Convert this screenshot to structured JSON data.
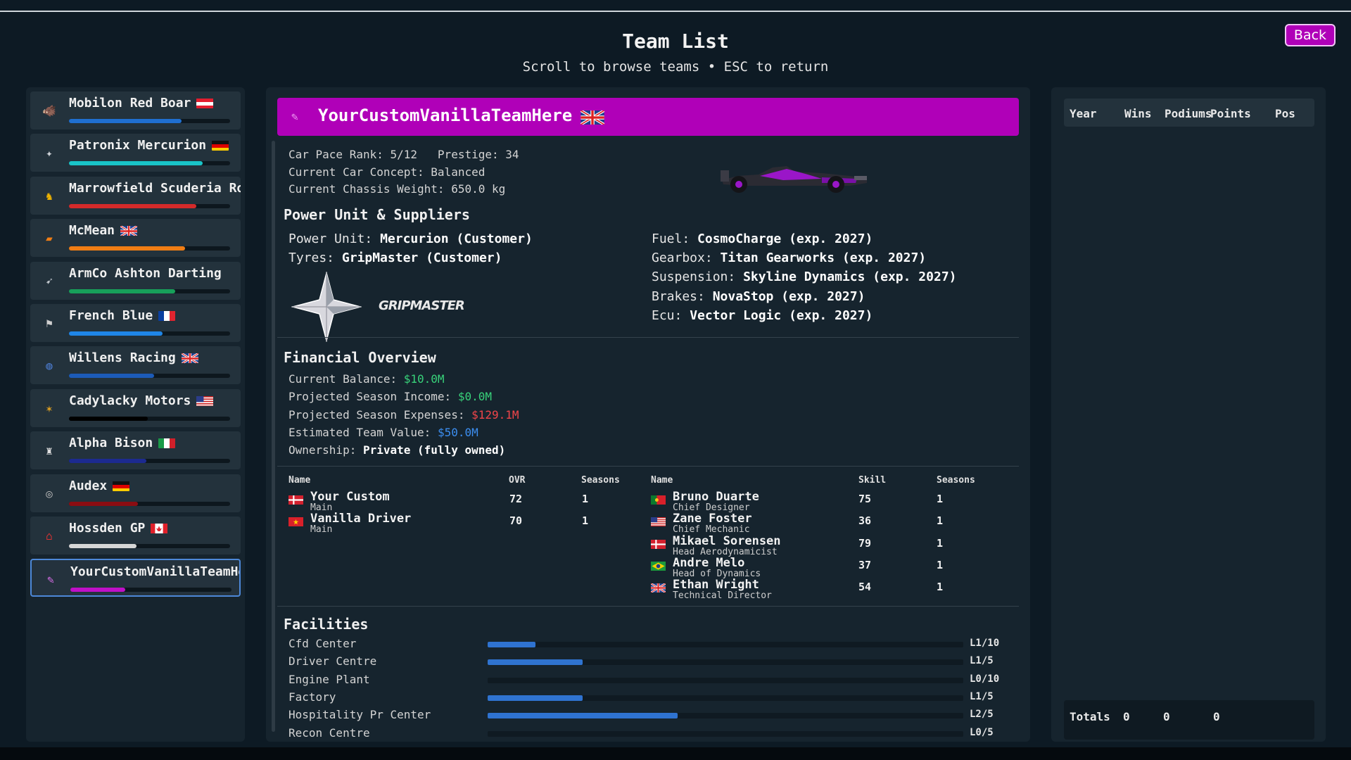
{
  "header": {
    "title": "Team List",
    "subtitle": "Scroll to browse teams • ESC to return",
    "back_label": "Back"
  },
  "teams": [
    {
      "name": "Mobilon Red Boar",
      "flag": "austria",
      "logo": "boar-logo-icon",
      "bar_color": "#1f6fd0",
      "performance": 0.7
    },
    {
      "name": "Patronix Mercurion",
      "flag": "germany",
      "logo": "star-logo-icon",
      "bar_color": "#19c4c8",
      "performance": 0.83
    },
    {
      "name": "Marrowfield Scuderia Ro",
      "flag": "",
      "logo": "horse-logo-icon",
      "bar_color": "#d42a2a",
      "performance": 0.79
    },
    {
      "name": "McMean",
      "flag": "uk",
      "logo": "mcmean-logo-icon",
      "bar_color": "#f07d14",
      "performance": 0.72
    },
    {
      "name": "ArmCo Ashton Darting",
      "flag": "",
      "logo": "wing-logo-icon",
      "bar_color": "#17a05a",
      "performance": 0.66
    },
    {
      "name": "French Blue",
      "flag": "france",
      "logo": "flag-logo-icon",
      "bar_color": "#1f86e8",
      "performance": 0.58
    },
    {
      "name": "Willens Racing",
      "flag": "uk",
      "logo": "w-logo-icon",
      "bar_color": "#1c5bb8",
      "performance": 0.53
    },
    {
      "name": "Cadylacky Motors",
      "flag": "usa",
      "logo": "crest-logo-icon",
      "bar_color": "#000000",
      "performance": 0.49
    },
    {
      "name": "Alpha Bison",
      "flag": "italy",
      "logo": "bison-logo-icon",
      "bar_color": "#1c2a90",
      "performance": 0.48
    },
    {
      "name": "Audex",
      "flag": "germany",
      "logo": "rings-logo-icon",
      "bar_color": "#8b0d12",
      "performance": 0.43
    },
    {
      "name": "Hossden GP",
      "flag": "canada",
      "logo": "h-logo-icon",
      "bar_color": "#d6d6d6",
      "performance": 0.42
    },
    {
      "name": "YourCustomVanillaTeamHe",
      "flag": "",
      "logo": "custom-logo-icon",
      "bar_color": "#c010c8",
      "performance": 0.34,
      "selected": true
    }
  ],
  "selected_team": {
    "name": "YourCustomVanillaTeamHere",
    "banner_color": "#b000b8",
    "flag": "uk",
    "pace_rank_line": "Car Pace Rank: 5/12   Prestige: 34",
    "concept_line": "Current Car Concept: Balanced",
    "chassis_line": "Current Chassis Weight: 650.0 kg"
  },
  "power_unit": {
    "title": "Power Unit & Suppliers",
    "power_unit_label": "Power Unit:",
    "power_unit_value": "Mercurion (Customer)",
    "tyres_label": "Tyres:",
    "tyres_value": "GripMaster (Customer)",
    "tyre_brand_logo": "GRIPMASTER",
    "suppliers": [
      {
        "label": "Fuel:",
        "value": "CosmoCharge (exp. 2027)"
      },
      {
        "label": "Gearbox:",
        "value": "Titan Gearworks (exp. 2027)"
      },
      {
        "label": "Suspension:",
        "value": "Skyline Dynamics (exp. 2027)"
      },
      {
        "label": "Brakes:",
        "value": "NovaStop (exp. 2027)"
      },
      {
        "label": "Ecu:",
        "value": "Vector Logic (exp. 2027)"
      }
    ]
  },
  "financial": {
    "title": "Financial Overview",
    "balance_label": "Current Balance:",
    "balance_value": "$10.0M",
    "income_label": "Projected Season Income:",
    "income_value": "$0.0M",
    "expenses_label": "Projected Season Expenses:",
    "expenses_value": "$129.1M",
    "value_label": "Estimated Team Value:",
    "value_value": "$50.0M",
    "ownership_label": "Ownership:",
    "ownership_value": "Private (fully owned)"
  },
  "drivers": {
    "headers": {
      "name": "Name",
      "ovr": "OVR",
      "seasons": "Seasons"
    },
    "rows": [
      {
        "name": "Your Custom",
        "role": "Main",
        "flag": "denmark",
        "ovr": "72",
        "seasons": "1"
      },
      {
        "name": "Vanilla Driver",
        "role": "Main",
        "flag": "vietnam",
        "ovr": "70",
        "seasons": "1"
      }
    ]
  },
  "staff": {
    "headers": {
      "name": "Name",
      "skill": "Skill",
      "seasons": "Seasons"
    },
    "rows": [
      {
        "name": "Bruno Duarte",
        "role": "Chief Designer",
        "flag": "portugal",
        "skill": "75",
        "seasons": "1"
      },
      {
        "name": "Zane Foster",
        "role": "Chief Mechanic",
        "flag": "usa",
        "skill": "36",
        "seasons": "1"
      },
      {
        "name": "Mikael Sorensen",
        "role": "Head Aerodynamicist",
        "flag": "denmark",
        "skill": "79",
        "seasons": "1"
      },
      {
        "name": "Andre Melo",
        "role": "Head of Dynamics",
        "flag": "brazil",
        "skill": "37",
        "seasons": "1"
      },
      {
        "name": "Ethan Wright",
        "role": "Technical Director",
        "flag": "uk",
        "skill": "54",
        "seasons": "1"
      }
    ]
  },
  "facilities": {
    "title": "Facilities",
    "items": [
      {
        "name": "Cfd Center",
        "level": "L1/10",
        "fill": 0.1
      },
      {
        "name": "Driver Centre",
        "level": "L1/5",
        "fill": 0.2
      },
      {
        "name": "Engine Plant",
        "level": "L0/10",
        "fill": 0.0
      },
      {
        "name": "Factory",
        "level": "L1/5",
        "fill": 0.2
      },
      {
        "name": "Hospitality Pr Center",
        "level": "L2/5",
        "fill": 0.4
      },
      {
        "name": "Recon Centre",
        "level": "L0/5",
        "fill": 0.0
      }
    ]
  },
  "history": {
    "headers": {
      "year": "Year",
      "wins": "Wins",
      "podiums": "Podiums",
      "points": "Points",
      "pos": "Pos"
    },
    "totals_label": "Totals",
    "totals": {
      "wins": "0",
      "podiums": "0",
      "points": "0"
    }
  }
}
